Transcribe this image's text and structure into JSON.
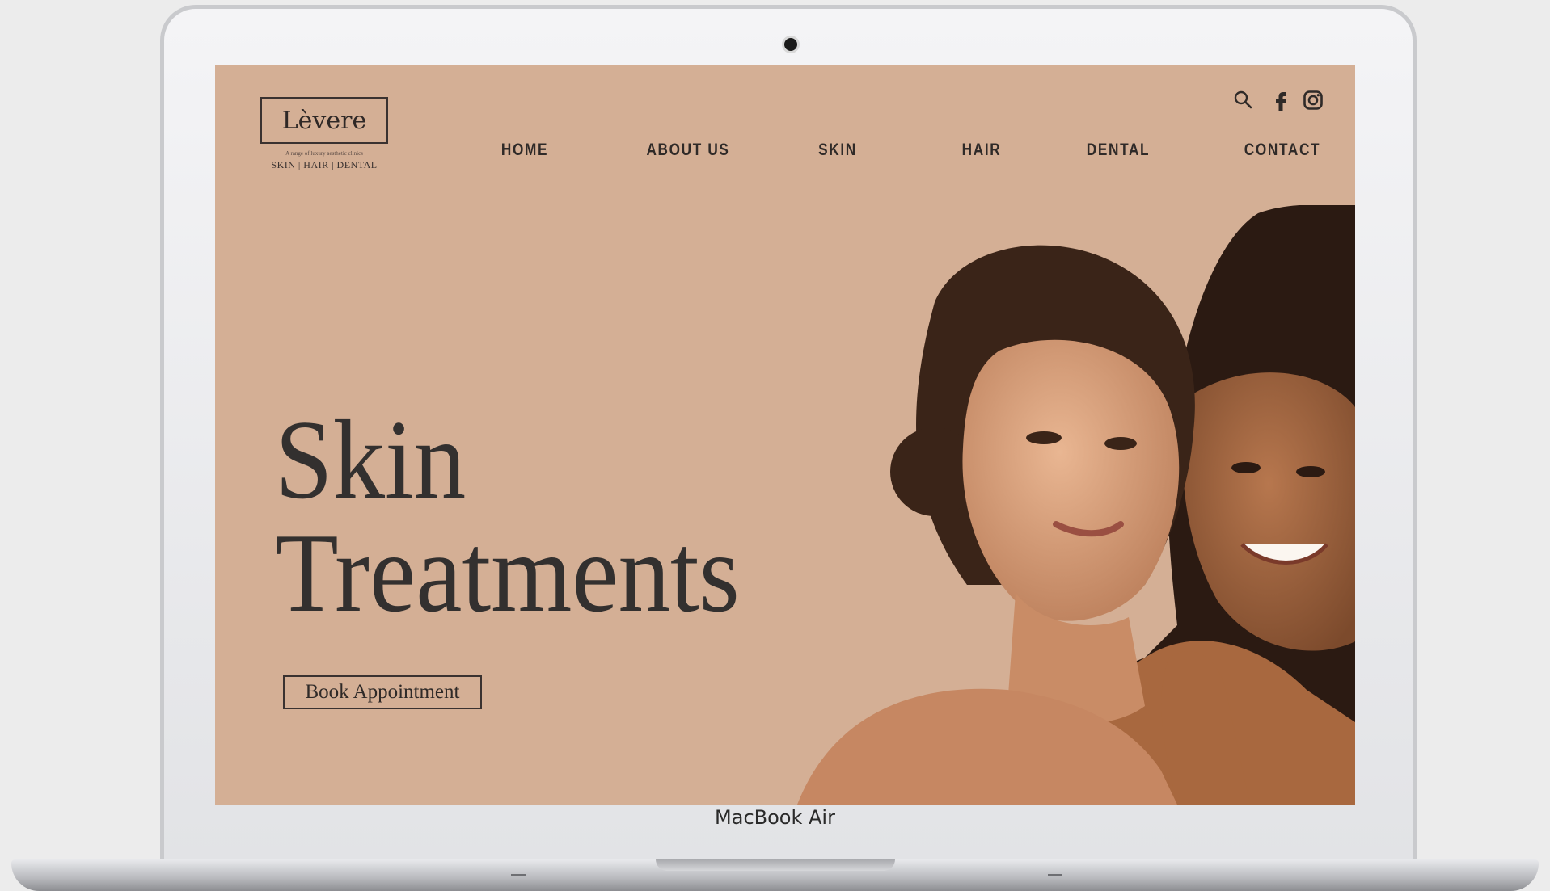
{
  "device": {
    "label": "MacBook Air"
  },
  "site": {
    "logo": "Lèvere",
    "tagline": "A range of luxury aesthetic clinics",
    "services_line": "SKIN  |  HAIR  |  DENTAL"
  },
  "nav": {
    "items": [
      "HOME",
      "ABOUT US",
      "SKIN",
      "HAIR",
      "DENTAL",
      "CONTACT"
    ]
  },
  "social": {
    "icons": [
      "search-icon",
      "facebook-icon",
      "instagram-icon"
    ]
  },
  "hero": {
    "title_line1": "Skin",
    "title_line2": "Treatments",
    "cta_label": "Book Appointment",
    "image": "two smiling women portrait"
  },
  "colors": {
    "page_background": "#d4af95",
    "text": "#2f2a28",
    "device_frame": "#e6e7ea"
  }
}
